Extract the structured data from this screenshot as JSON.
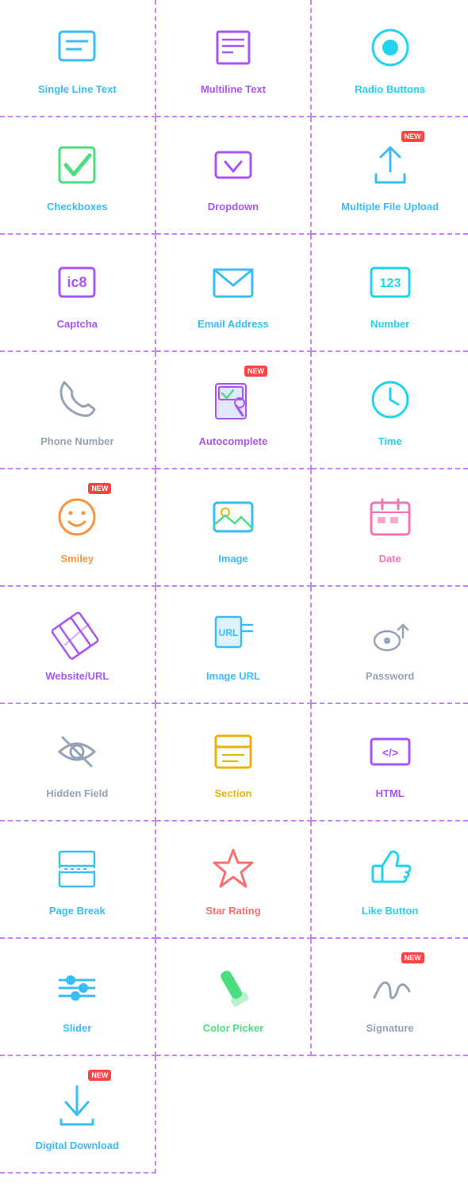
{
  "cells": [
    {
      "label": "Single Line Text",
      "icon": "single-line",
      "color": "#38bdf8",
      "new": false
    },
    {
      "label": "Multiline Text",
      "icon": "multiline",
      "color": "#a855f7",
      "new": false
    },
    {
      "label": "Radio Buttons",
      "icon": "radio",
      "color": "#22d3ee",
      "new": false
    },
    {
      "label": "Checkboxes",
      "icon": "checkbox",
      "color": "#38bdf8",
      "new": false
    },
    {
      "label": "Dropdown",
      "icon": "dropdown",
      "color": "#a855f7",
      "new": false
    },
    {
      "label": "Multiple File Upload",
      "icon": "file-upload",
      "color": "#38bdf8",
      "new": true
    },
    {
      "label": "Captcha",
      "icon": "captcha",
      "color": "#a855f7",
      "new": false
    },
    {
      "label": "Email Address",
      "icon": "email",
      "color": "#38bdf8",
      "new": false
    },
    {
      "label": "Number",
      "icon": "number",
      "color": "#22d3ee",
      "new": false
    },
    {
      "label": "Phone Number",
      "icon": "phone",
      "color": "#94a3b8",
      "new": false
    },
    {
      "label": "Autocomplete",
      "icon": "autocomplete",
      "color": "#a855f7",
      "new": true
    },
    {
      "label": "Time",
      "icon": "time",
      "color": "#22d3ee",
      "new": false
    },
    {
      "label": "Smiley",
      "icon": "smiley",
      "color": "#fb923c",
      "new": true
    },
    {
      "label": "Image",
      "icon": "image",
      "color": "#38bdf8",
      "new": false
    },
    {
      "label": "Date",
      "icon": "date",
      "color": "#f472b6",
      "new": false
    },
    {
      "label": "Website/URL",
      "icon": "url",
      "color": "#a855f7",
      "new": false
    },
    {
      "label": "Image URL",
      "icon": "image-url",
      "color": "#38bdf8",
      "new": false
    },
    {
      "label": "Password",
      "icon": "password",
      "color": "#94a3b8",
      "new": false
    },
    {
      "label": "Hidden Field",
      "icon": "hidden",
      "color": "#94a3b8",
      "new": false
    },
    {
      "label": "Section",
      "icon": "section",
      "color": "#eab308",
      "new": false
    },
    {
      "label": "HTML",
      "icon": "html",
      "color": "#a855f7",
      "new": false
    },
    {
      "label": "Page Break",
      "icon": "page-break",
      "color": "#38bdf8",
      "new": false
    },
    {
      "label": "Star Rating",
      "icon": "star",
      "color": "#f87171",
      "new": false
    },
    {
      "label": "Like Button",
      "icon": "like",
      "color": "#22d3ee",
      "new": false
    },
    {
      "label": "Slider",
      "icon": "slider",
      "color": "#38bdf8",
      "new": false
    },
    {
      "label": "Color Picker",
      "icon": "color-picker",
      "color": "#4ade80",
      "new": false
    },
    {
      "label": "Signature",
      "icon": "signature",
      "color": "#94a3b8",
      "new": true
    },
    {
      "label": "Digital Download",
      "icon": "download",
      "color": "#38bdf8",
      "new": true
    }
  ]
}
